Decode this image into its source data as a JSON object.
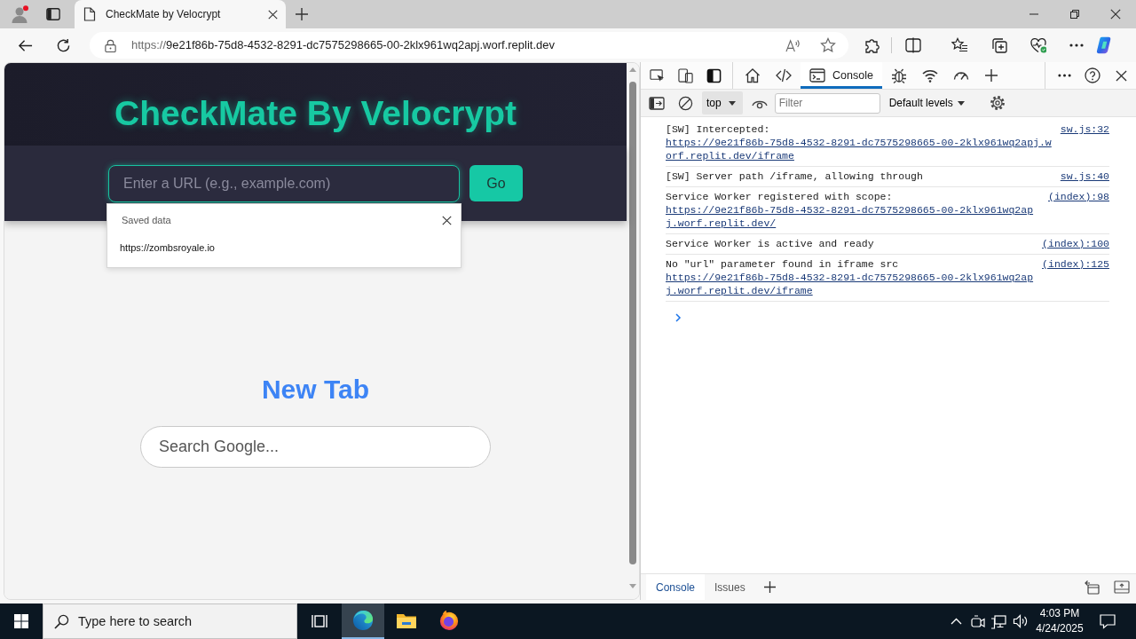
{
  "browser": {
    "tabs": [
      {
        "title": "CheckMate by Velocrypt",
        "selected": true
      }
    ],
    "address_bar": {
      "scheme": "https://",
      "host": "9e21f86b-75d8-4532-8291-dc7575298665-00-2klx961wq2apj.worf.replit.dev"
    }
  },
  "page": {
    "title": "CheckMate By Velocrypt",
    "url_field": {
      "placeholder": "Enter a URL (e.g., example.com)"
    },
    "go_button": "Go",
    "autofill": {
      "heading": "Saved data",
      "entries": [
        "https://zombsroyale.io"
      ]
    },
    "new_tab": {
      "heading": "New Tab",
      "search_field": {
        "placeholder": "Search Google..."
      }
    }
  },
  "devtools": {
    "tabs": [
      {
        "kind": "welcome",
        "selected": false
      },
      {
        "kind": "elements",
        "selected": false
      },
      {
        "kind": "console",
        "label": "Console",
        "selected": true
      },
      {
        "kind": "sources",
        "selected": false
      },
      {
        "kind": "network",
        "selected": false
      },
      {
        "kind": "performance",
        "selected": false
      }
    ],
    "context": "top",
    "filter": {
      "placeholder": "Filter"
    },
    "levels": "Default levels",
    "messages": [
      {
        "text": "[SW] Intercepted:",
        "link": "https://9e21f86b-75d8-4532-8291-dc7575298665-00-2klx961wq2apj.worf.replit.dev/iframe",
        "source": "sw.js:32"
      },
      {
        "text": "[SW] Server path /iframe, allowing through",
        "source": "sw.js:40"
      },
      {
        "text": "Service Worker registered with scope:",
        "link": "https://9e21f86b-75d8-4532-8291-dc7575298665-00-2klx961wq2apj.worf.replit.dev/",
        "source": "(index):98"
      },
      {
        "text": "Service Worker is active and ready",
        "source": "(index):100"
      },
      {
        "text": "No \"url\" parameter found in iframe src",
        "link": "https://9e21f86b-75d8-4532-8291-dc7575298665-00-2klx961wq2apj.worf.replit.dev/iframe",
        "source": "(index):125"
      }
    ],
    "drawer_tabs": [
      {
        "label": "Console",
        "selected": true
      },
      {
        "label": "Issues",
        "selected": false
      }
    ]
  },
  "taskbar": {
    "search": {
      "placeholder": "Type here to search"
    },
    "apps": [
      {
        "kind": "edge",
        "selected": true
      },
      {
        "kind": "explorer",
        "selected": false
      },
      {
        "kind": "firefox",
        "selected": false
      }
    ],
    "clock": {
      "time": "4:03 PM",
      "date": "4/24/2025"
    }
  }
}
